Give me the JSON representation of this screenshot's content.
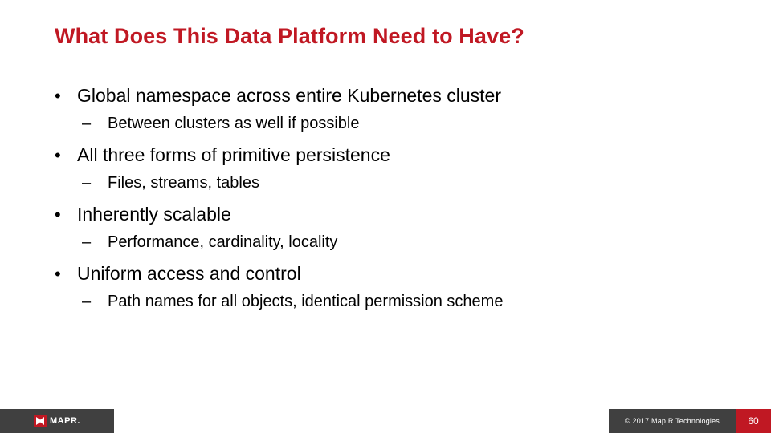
{
  "title": "What Does This Data Platform Need to Have?",
  "bullets": {
    "b0": "Global namespace across entire Kubernetes cluster",
    "b0s0": "Between clusters as well if possible",
    "b1": "All three forms of primitive persistence",
    "b1s0": "Files, streams, tables",
    "b2": "Inherently scalable",
    "b2s0": "Performance, cardinality, locality",
    "b3": "Uniform access and control",
    "b3s0": "Path names for all objects, identical permission scheme"
  },
  "footer": {
    "logo_text": "MAPR.",
    "copyright": "© 2017 Map.R Technologies",
    "page": "60"
  }
}
